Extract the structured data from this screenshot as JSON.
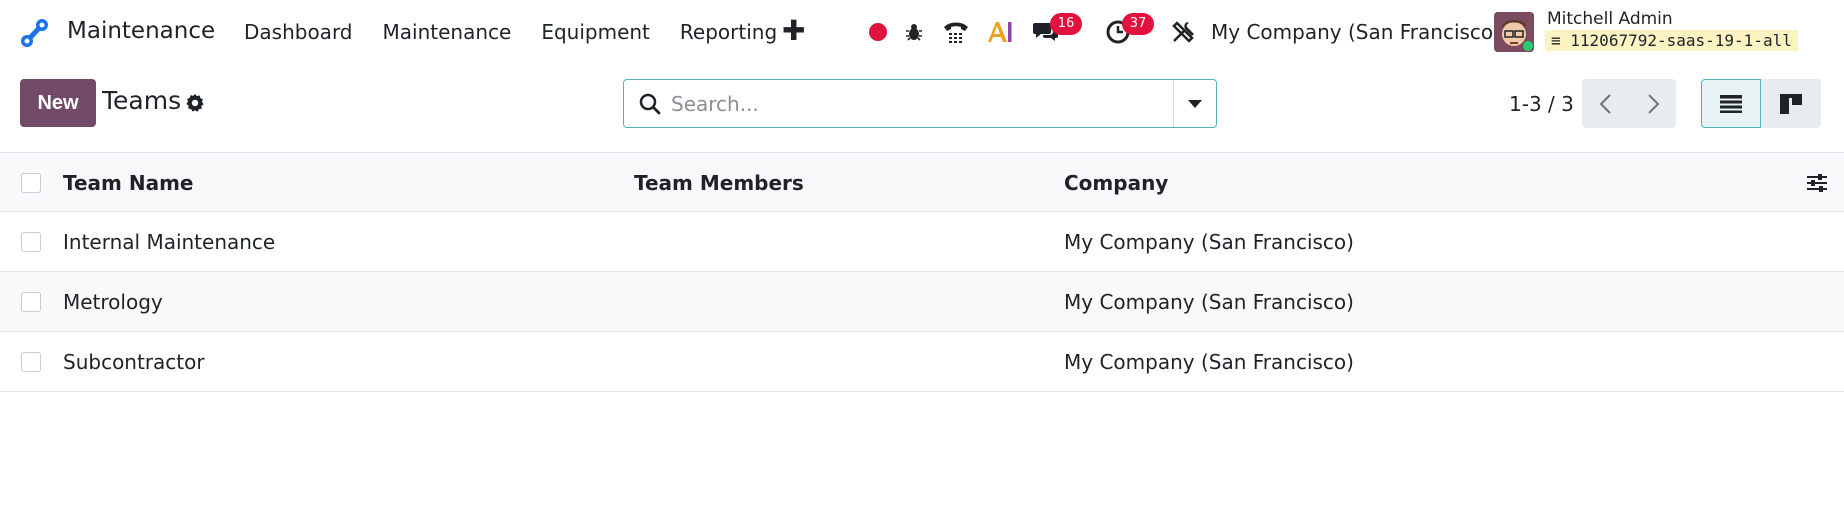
{
  "app": {
    "name": "Maintenance"
  },
  "menu": {
    "items": [
      "Dashboard",
      "Maintenance",
      "Equipment",
      "Reporting"
    ]
  },
  "systray": {
    "messages_count": "16",
    "activities_count": "37",
    "company": "My Company (San Francisco)",
    "user_name": "Mitchell Admin",
    "db_name": "112067792-saas-19-1-all"
  },
  "control": {
    "new_label": "New",
    "title": "Teams",
    "search_placeholder": "Search...",
    "pager": "1-3 / 3"
  },
  "table": {
    "headers": [
      "Team Name",
      "Team Members",
      "Company"
    ],
    "rows": [
      {
        "name": "Internal Maintenance",
        "members": "",
        "company": "My Company (San Francisco)"
      },
      {
        "name": "Metrology",
        "members": "",
        "company": "My Company (San Francisco)"
      },
      {
        "name": "Subcontractor",
        "members": "",
        "company": "My Company (San Francisco)"
      }
    ]
  },
  "colors": {
    "brand": "#714b67",
    "accent": "#4fb3bd",
    "badge": "#e1123d"
  },
  "icons": [
    "app-logo-icon",
    "plus-icon",
    "record-icon",
    "bug-icon",
    "phone-icon",
    "ai-icon",
    "chat-icon",
    "clock-icon",
    "tools-icon",
    "gear-icon",
    "search-icon",
    "chevron-down-icon",
    "chevron-left-icon",
    "chevron-right-icon",
    "list-view-icon",
    "kanban-view-icon",
    "sliders-icon"
  ]
}
